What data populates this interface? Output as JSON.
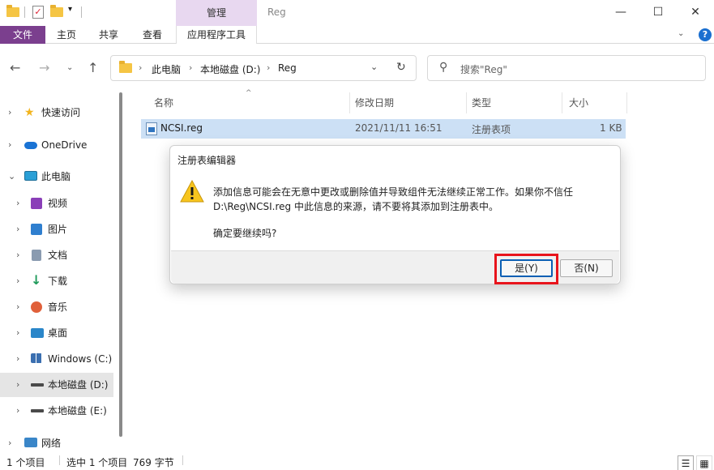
{
  "titlebar": {
    "manage_tab": "管理",
    "window_title": "Reg",
    "minimize": "—",
    "maximize": "☐",
    "close": "✕",
    "qa_down": "▾"
  },
  "ribbon": {
    "tabs": [
      "文件",
      "主页",
      "共享",
      "查看",
      "应用程序工具"
    ],
    "chevron": "⌄",
    "help": "?"
  },
  "nav": {
    "back": "←",
    "forward": "→",
    "recent": "⌄",
    "up": "↑",
    "breadcrumb": [
      "此电脑",
      "本地磁盘 (D:)",
      "Reg"
    ],
    "crumb_sep": "›",
    "dropdown": "⌄",
    "refresh": "↻",
    "search_placeholder": "搜索\"Reg\"",
    "search_icon": "⚲"
  },
  "sidebar": {
    "items": [
      {
        "label": "快速访问",
        "icon": "star-icon",
        "color": "#f2b41e"
      },
      {
        "label": "OneDrive",
        "icon": "cloud-icon",
        "color": "#1a73d4"
      },
      {
        "label": "此电脑",
        "icon": "computer-icon",
        "color": "#2a9fd6"
      },
      {
        "label": "视频",
        "icon": "video-icon",
        "color": "#8a3fb8"
      },
      {
        "label": "图片",
        "icon": "picture-icon",
        "color": "#2f7fcf"
      },
      {
        "label": "文档",
        "icon": "document-icon",
        "color": "#6b7d92"
      },
      {
        "label": "下载",
        "icon": "download-icon",
        "color": "#1e9a5a"
      },
      {
        "label": "音乐",
        "icon": "music-icon",
        "color": "#e0603a"
      },
      {
        "label": "桌面",
        "icon": "desktop-icon",
        "color": "#2a86c9"
      },
      {
        "label": "Windows (C:)",
        "icon": "drive-icon",
        "color": "#3b6fb0"
      },
      {
        "label": "本地磁盘 (D:)",
        "icon": "drive-icon",
        "color": "#4a4a4a"
      },
      {
        "label": "本地磁盘 (E:)",
        "icon": "drive-icon",
        "color": "#4a4a4a"
      },
      {
        "label": "网络",
        "icon": "network-icon",
        "color": "#3a86c8"
      }
    ],
    "collapsed_chevron": "›",
    "expanded_chevron": "⌄"
  },
  "filelist": {
    "columns": [
      "名称",
      "修改日期",
      "类型",
      "大小"
    ],
    "sort_indicator": "^",
    "rows": [
      {
        "name": "NCSI.reg",
        "date": "2021/11/11 16:51",
        "type": "注册表项",
        "size": "1 KB"
      }
    ]
  },
  "status": {
    "count": "1 个项目",
    "selected": "选中 1 个项目",
    "size": "769 字节",
    "details_view": "☰",
    "tiles_view": "▦"
  },
  "dialog": {
    "title": "注册表编辑器",
    "message_line1": "添加信息可能会在无意中更改或删除值并导致组件无法继续正常工作。如果你不信任",
    "message_line2": "D:\\Reg\\NCSI.reg 中此信息的来源，请不要将其添加到注册表中。",
    "question": "确定要继续吗?",
    "yes_label": "是(Y)",
    "no_label": "否(N)",
    "highlight_color": "#e8141c"
  }
}
